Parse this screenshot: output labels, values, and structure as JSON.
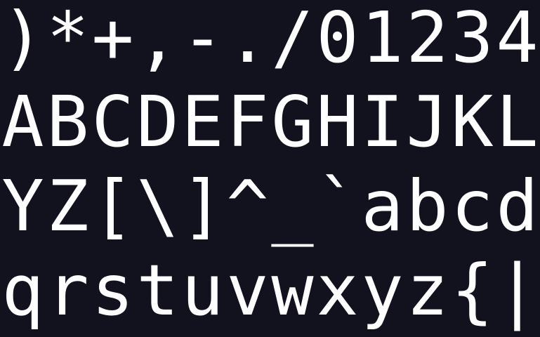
{
  "colors": {
    "background": "#12121f",
    "foreground": "#ffffff"
  },
  "rows": [
    [
      ")",
      "*",
      "+",
      ",",
      "-",
      ".",
      "/",
      "0",
      "1",
      "2",
      "3",
      "4"
    ],
    [
      "A",
      "B",
      "C",
      "D",
      "E",
      "F",
      "G",
      "H",
      "I",
      "J",
      "K",
      "L"
    ],
    [
      "Y",
      "Z",
      "[",
      "\\",
      "]",
      "^",
      "_",
      "`",
      "a",
      "b",
      "c",
      "d"
    ],
    [
      "q",
      "r",
      "s",
      "t",
      "u",
      "v",
      "w",
      "x",
      "y",
      "z",
      "{",
      "|"
    ]
  ]
}
